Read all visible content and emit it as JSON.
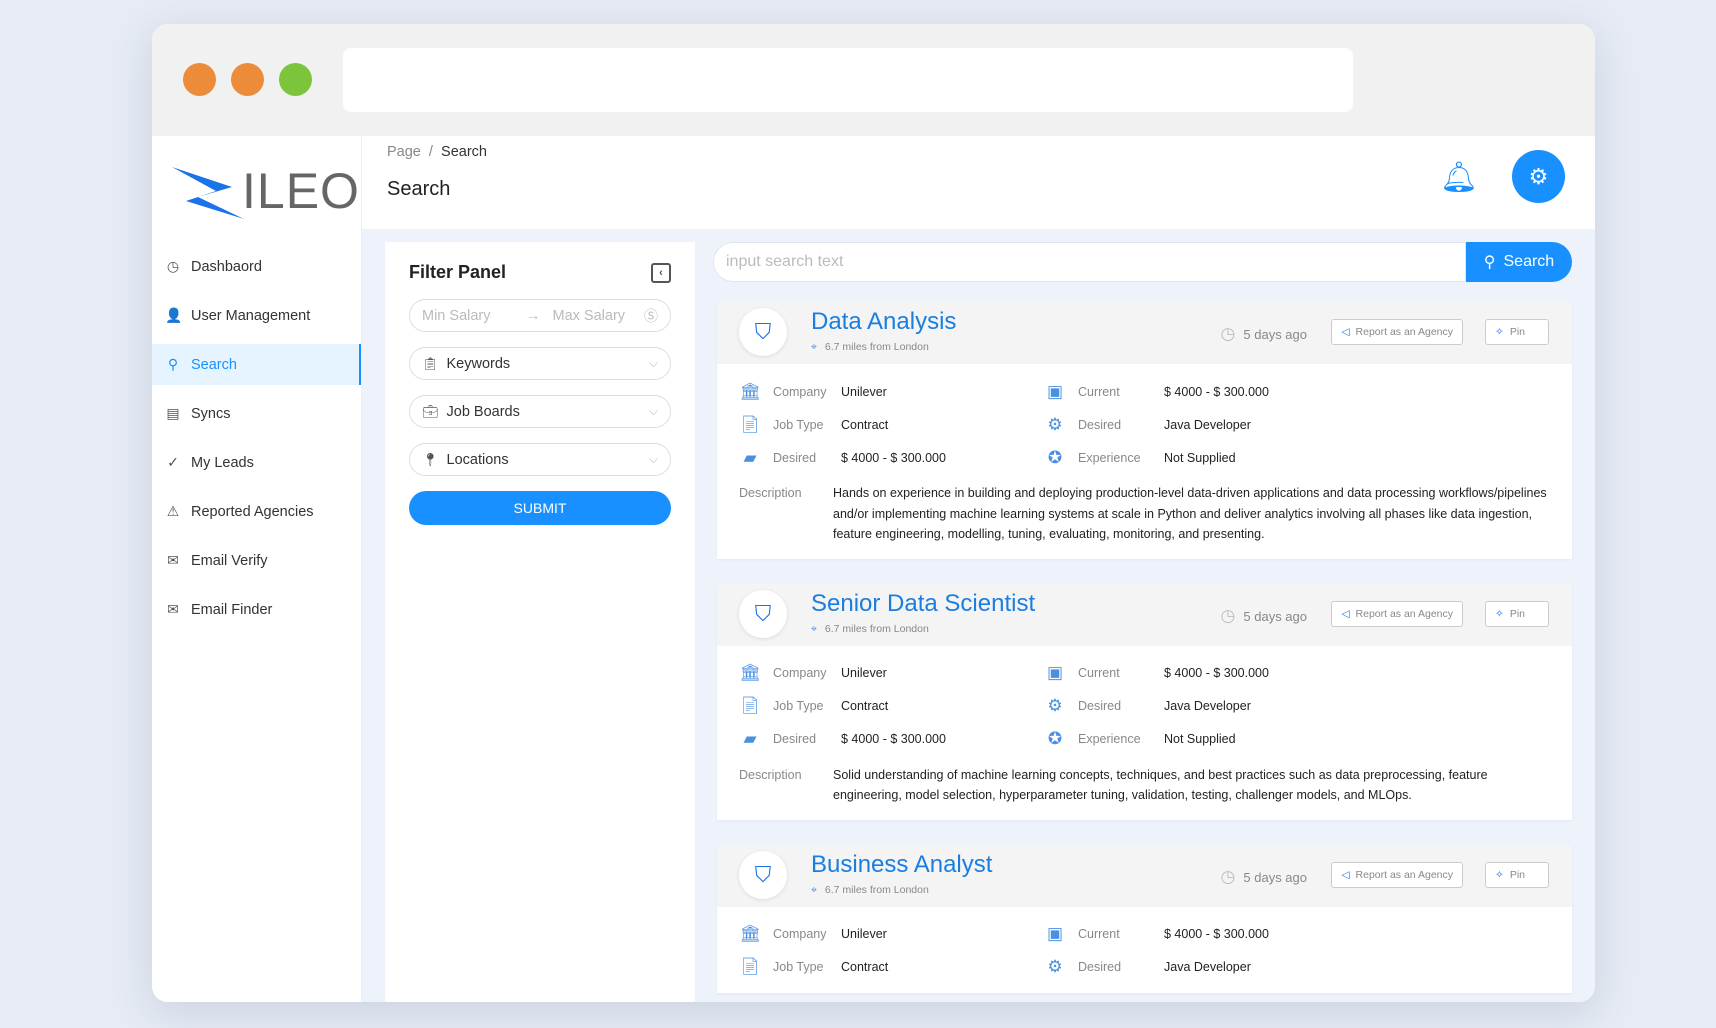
{
  "window": {
    "dot_colors": [
      "#ec8c3a",
      "#ec8c3a",
      "#7cc43c"
    ]
  },
  "brand": {
    "logo_text": "ILEO",
    "accent": "#1890ff"
  },
  "sidebar": {
    "items": [
      {
        "label": "Dashbaord",
        "icon": "dashboard-icon",
        "glyph": "◷"
      },
      {
        "label": "User Management",
        "icon": "user-icon",
        "glyph": "👤"
      },
      {
        "label": "Search",
        "icon": "search-icon",
        "glyph": "⚲",
        "active": true
      },
      {
        "label": "Syncs",
        "icon": "syncs-icon",
        "glyph": "▤"
      },
      {
        "label": "My Leads",
        "icon": "check-circle-icon",
        "glyph": "✓"
      },
      {
        "label": "Reported Agencies",
        "icon": "warning-icon",
        "glyph": "⚠"
      },
      {
        "label": "Email Verify",
        "icon": "mail-icon",
        "glyph": "✉"
      },
      {
        "label": "Email Finder",
        "icon": "mail-icon",
        "glyph": "✉"
      }
    ]
  },
  "header": {
    "breadcrumb": [
      "Page",
      "Search"
    ],
    "title": "Search"
  },
  "filter": {
    "title": "Filter Panel",
    "min_placeholder": "Min Salary",
    "max_placeholder": "Max Salary",
    "keywords": "Keywords",
    "job_boards": "Job Boards",
    "locations": "Locations",
    "submit": "SUBMIT"
  },
  "search": {
    "placeholder": "input search text",
    "button": "Search"
  },
  "jobs": [
    {
      "title": "Data Analysis",
      "distance": "6.7 miles from London",
      "ago": "5 days ago",
      "report": "Report as an Agency",
      "pin": "Pin",
      "company_label": "Company",
      "company": "Unilever",
      "jobtype_label": "Job Type",
      "jobtype": "Contract",
      "desired_salary_label": "Desired",
      "desired_salary": "$ 4000 - $ 300.000",
      "current_label": "Current",
      "current": "$ 4000 - $ 300.000",
      "desired_role_label": "Desired",
      "desired_role": "Java Developer",
      "experience_label": "Experience",
      "experience": "Not Supplied",
      "description_label": "Description",
      "description": "Hands on experience in building and deploying production-level data-driven applications and data processing workflows/pipelines and/or implementing machine learning systems at scale in Python and deliver analytics involving all phases like data ingestion, feature engineering, modelling, tuning, evaluating, monitoring, and presenting."
    },
    {
      "title": "Senior Data Scientist",
      "distance": "6.7 miles from London",
      "ago": "5 days ago",
      "report": "Report as an Agency",
      "pin": "Pin",
      "company_label": "Company",
      "company": "Unilever",
      "jobtype_label": "Job Type",
      "jobtype": "Contract",
      "desired_salary_label": "Desired",
      "desired_salary": "$ 4000 - $ 300.000",
      "current_label": "Current",
      "current": "$ 4000 - $ 300.000",
      "desired_role_label": "Desired",
      "desired_role": "Java Developer",
      "experience_label": "Experience",
      "experience": "Not Supplied",
      "description_label": "Description",
      "description": "Solid understanding of machine learning concepts, techniques, and best practices such as data preprocessing, feature engineering, model selection, hyperparameter tuning, validation, testing, challenger models, and MLOps."
    },
    {
      "title": "Business Analyst",
      "distance": "6.7 miles from London",
      "ago": "5 days ago",
      "report": "Report as an Agency",
      "pin": "Pin",
      "company_label": "Company",
      "company": "Unilever",
      "jobtype_label": "Job Type",
      "jobtype": "Contract",
      "current_label": "Current",
      "current": "$ 4000 - $ 300.000",
      "desired_role_label": "Desired",
      "desired_role": "Java Developer"
    }
  ]
}
